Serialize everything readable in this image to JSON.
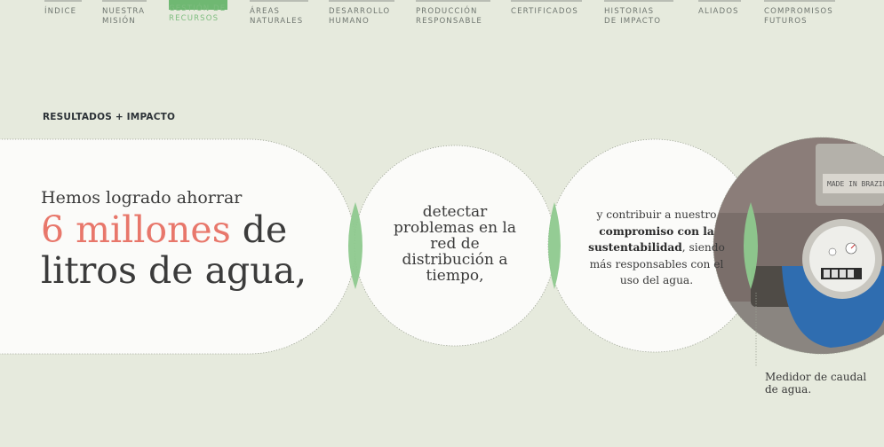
{
  "nav": {
    "items": [
      {
        "label": "ÍNDICE",
        "active": false
      },
      {
        "label": "NUESTRA\nMISIÓN",
        "active": false
      },
      {
        "label": "GESTIÓN DE\nRECURSOS",
        "active": true
      },
      {
        "label": "ÁREAS\nNATURALES",
        "active": false
      },
      {
        "label": "DESARROLLO\nHUMANO",
        "active": false
      },
      {
        "label": "PRODUCCIÓN\nRESPONSABLE",
        "active": false
      },
      {
        "label": "CERTIFICADOS",
        "active": false
      },
      {
        "label": "HISTORIAS\nDE IMPACTO",
        "active": false
      },
      {
        "label": "ALIADOS",
        "active": false
      },
      {
        "label": "COMPROMISOS\nFUTUROS",
        "active": false
      }
    ]
  },
  "section": {
    "label": "RESULTADOS + IMPACTO"
  },
  "bubble1": {
    "lead": "Hemos logrado ahorrar",
    "highlight": "6 millones",
    "after_highlight": " de",
    "line2": "litros de agua,"
  },
  "bubble2": {
    "text": "detectar problemas en la red de distribución a tiempo,"
  },
  "bubble3": {
    "before": "y contribuir a nuestro ",
    "bold": "compromiso con la sustentabilidad",
    "after": ", siendo más responsables con el uso del agua."
  },
  "photo": {
    "caption": "Medidor de caudal de agua.",
    "meter_label": "MADE IN BRAZIL"
  },
  "colors": {
    "background": "#e6eadd",
    "accent_green": "#6fb872",
    "highlight_coral": "#e8776b",
    "bubble_fill": "#fbfbf9"
  }
}
